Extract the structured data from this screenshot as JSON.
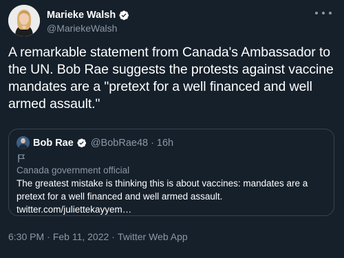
{
  "author": {
    "display_name": "Marieke Walsh",
    "handle": "@MariekeWalsh",
    "verified": true
  },
  "more_icon": "more-horizontal-icon",
  "tweet_text": "A remarkable statement from Canada's Ambassador to the UN. Bob Rae suggests the protests against vaccine mandates are a \"pretext for a well financed and well armed assault.\"",
  "quoted_tweet": {
    "display_name": "Bob Rae",
    "handle": "@BobRae48",
    "separator": "·",
    "time": "16h",
    "verified": true,
    "flag_icon": "flag-icon",
    "label": "Canada government official",
    "text": "The greatest mistake is thinking this is about vaccines: mandates are a pretext for a well financed and well armed assault.",
    "link": "twitter.com/juliettekayyem…"
  },
  "meta": {
    "time": "6:30 PM",
    "date": "Feb 11, 2022",
    "source": "Twitter Web App",
    "separator": "·"
  },
  "colors": {
    "background": "#15202b",
    "text": "#ffffff",
    "secondary": "#8b98a5",
    "border": "#38444d",
    "verified": "#1d9bf0"
  }
}
